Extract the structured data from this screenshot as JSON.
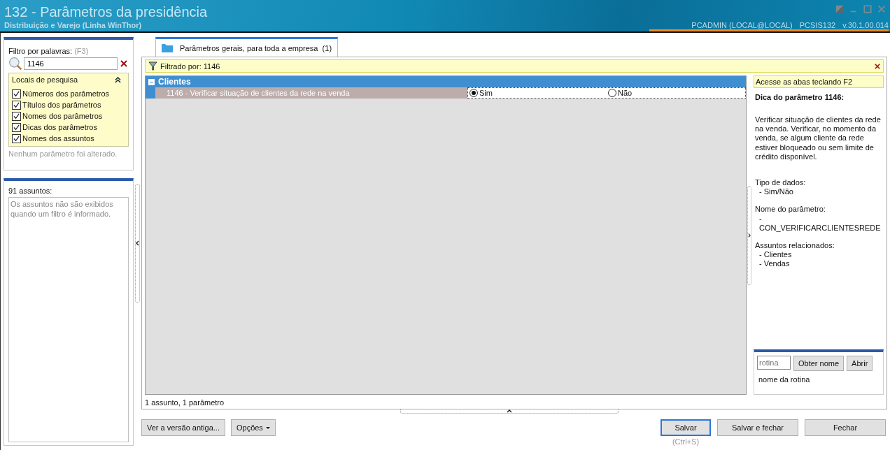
{
  "window": {
    "title": "132 - Parâmetros da presidência",
    "subtitle": "Distribuição e Varejo (Linha WinThor)",
    "user": "PCADMIN (LOCAL@LOCAL)",
    "program": "PCSIS132",
    "version": "v.30.1.00.014"
  },
  "filter": {
    "label": "Filtro por palavras:",
    "hint": "(F3)",
    "value": "1146"
  },
  "search_locations": {
    "title": "Locais de pesquisa",
    "expanded": true,
    "options": [
      {
        "label": "Números dos parâmetros",
        "checked": true
      },
      {
        "label": "Títulos dos parâmetros",
        "checked": true
      },
      {
        "label": "Nomes dos parâmetros",
        "checked": true
      },
      {
        "label": "Dicas dos parâmetros",
        "checked": true
      },
      {
        "label": "Nomes dos assuntos",
        "checked": true
      }
    ]
  },
  "change_note": "Nenhum parâmetro foi alterado.",
  "subjects": {
    "count_label": "91 assuntos:",
    "message": "Os assuntos não são exibidos quando um filtro é informado."
  },
  "tabs": [
    {
      "label": "Parâmetros gerais, para toda a empresa",
      "count": "(1)",
      "selected": true
    }
  ],
  "filter_bar": "Filtrado por: 1146",
  "groups": [
    {
      "name": "Clientes",
      "expanded": true,
      "params": [
        {
          "label": "1146 - Verificar situação de clientes da rede na venda",
          "options": [
            {
              "label": "Sim",
              "selected": true
            },
            {
              "label": "Não",
              "selected": false
            }
          ]
        }
      ]
    }
  ],
  "summary": "1 assunto, 1 parâmetro",
  "hint_panel": {
    "shortcut": "Acesse as abas teclando F2",
    "title": "Dica do parâmetro 1146:",
    "description": "Verificar situação de clientes da rede na venda. Verificar, no momento da venda, se algum cliente da rede estiver bloqueado ou sem limite de crédito disponível.",
    "sections": [
      {
        "heading": "Tipo de dados:",
        "items": [
          "- Sim/Não"
        ]
      },
      {
        "heading": "Nome do parâmetro:",
        "items": [
          "- CON_VERIFICARCLIENTESREDE"
        ]
      },
      {
        "heading": "Assuntos relacionados:",
        "items": [
          "- Clientes",
          "- Vendas"
        ]
      }
    ]
  },
  "routine": {
    "placeholder": "rotina",
    "buttons": [
      "Obter nome",
      "Abrir"
    ],
    "name_label": "nome da rotina"
  },
  "footer_left": [
    {
      "label": "Ver a versão antiga...",
      "kind": "plain"
    },
    {
      "label": "Opções",
      "kind": "dropdown"
    }
  ],
  "footer_right": [
    {
      "label": "Salvar",
      "default": true
    },
    {
      "label": "Salvar e fechar",
      "default": false
    },
    {
      "label": "Fechar",
      "default": false
    }
  ],
  "save_shortcut": "(Ctrl+S)"
}
